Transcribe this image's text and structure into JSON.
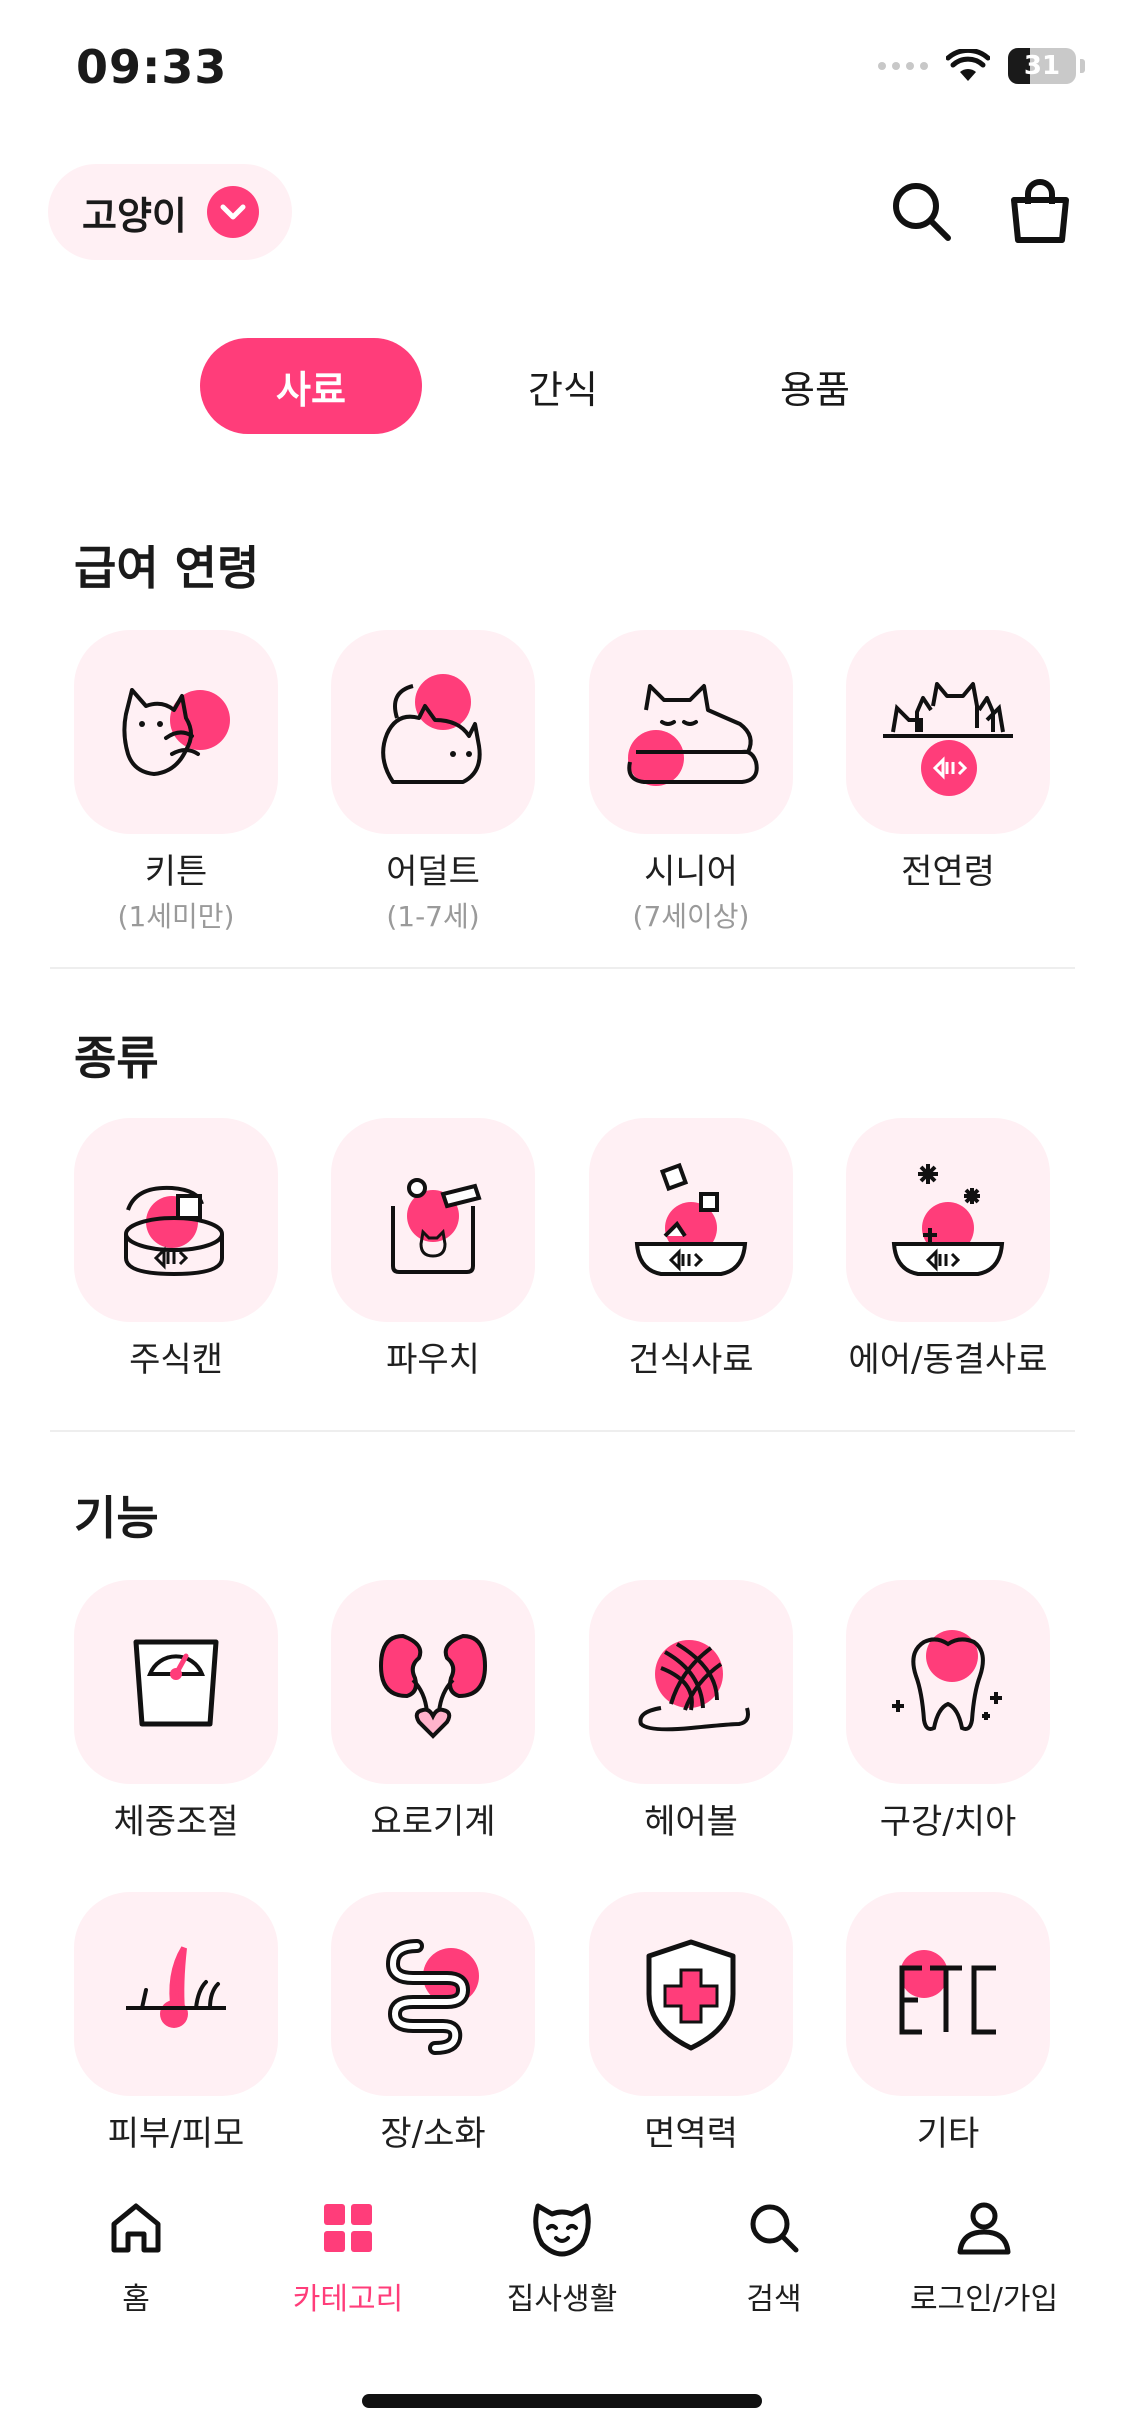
{
  "status": {
    "time": "09:33",
    "battery": "31"
  },
  "header": {
    "pet_selector": "고양이"
  },
  "tabs": [
    {
      "label": "사료",
      "active": true
    },
    {
      "label": "간식",
      "active": false
    },
    {
      "label": "용품",
      "active": false
    }
  ],
  "sections": {
    "age": {
      "title": "급여 연령",
      "items": [
        {
          "label": "키튼",
          "sub": "(1세미만)",
          "icon": "kitten-icon"
        },
        {
          "label": "어덜트",
          "sub": "(1-7세)",
          "icon": "adult-cat-icon"
        },
        {
          "label": "시니어",
          "sub": "(7세이상)",
          "icon": "senior-cat-icon"
        },
        {
          "label": "전연령",
          "sub": "",
          "icon": "all-ages-icon"
        }
      ]
    },
    "type": {
      "title": "종류",
      "items": [
        {
          "label": "주식캔",
          "icon": "main-can-icon"
        },
        {
          "label": "파우치",
          "icon": "pouch-icon"
        },
        {
          "label": "건식사료",
          "icon": "dry-food-icon"
        },
        {
          "label": "에어/동결사료",
          "icon": "freeze-dried-icon"
        }
      ]
    },
    "function": {
      "title": "기능",
      "items": [
        {
          "label": "체중조절",
          "icon": "scale-icon"
        },
        {
          "label": "요로기계",
          "icon": "kidney-icon"
        },
        {
          "label": "헤어볼",
          "icon": "yarn-ball-icon"
        },
        {
          "label": "구강/치아",
          "icon": "tooth-icon"
        },
        {
          "label": "피부/피모",
          "icon": "skin-hair-icon"
        },
        {
          "label": "장/소화",
          "icon": "intestine-icon"
        },
        {
          "label": "면역력",
          "icon": "shield-icon"
        },
        {
          "label": "기타",
          "icon": "etc-icon"
        }
      ]
    }
  },
  "bottom_nav": [
    {
      "label": "홈",
      "icon": "home-icon",
      "active": false
    },
    {
      "label": "카테고리",
      "icon": "grid-icon",
      "active": true
    },
    {
      "label": "집사생활",
      "icon": "cat-face-icon",
      "active": false
    },
    {
      "label": "검색",
      "icon": "search-icon",
      "active": false
    },
    {
      "label": "로그인/가입",
      "icon": "user-icon",
      "active": false
    }
  ],
  "colors": {
    "accent": "#ff3d7a",
    "tile_bg": "#fff0f4",
    "divider": "#eeeeee"
  }
}
